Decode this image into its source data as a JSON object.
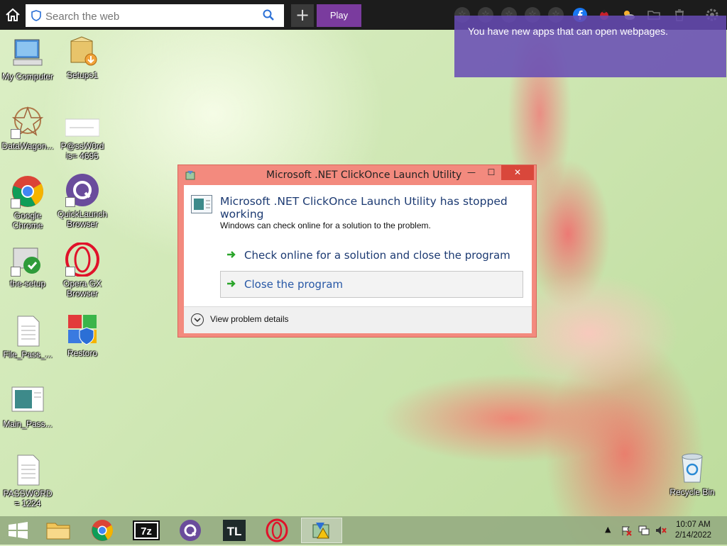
{
  "topbar": {
    "search_placeholder": "Search the web",
    "plus_label": "+",
    "play_label": "Play",
    "favorites_count": 5
  },
  "notification": {
    "text": "You have new apps that can open webpages."
  },
  "desktop_icons": [
    {
      "label": "My Computer",
      "icon": "computer-icon"
    },
    {
      "label": "Setups1",
      "icon": "installer-box-icon"
    },
    {
      "label": "DataWagon...",
      "icon": "datawagon-icon"
    },
    {
      "label": "P@ssW0rd is=  4695",
      "icon": "text-file-icon"
    },
    {
      "label": "Google Chrome",
      "icon": "chrome-icon"
    },
    {
      "label": "QuickLaunch Browser",
      "icon": "quicklaunch-icon"
    },
    {
      "label": "the-setup",
      "icon": "setup-icon"
    },
    {
      "label": "Opera GX Browser",
      "icon": "opera-icon"
    },
    {
      "label": "File_Pass_...",
      "icon": "document-icon"
    },
    {
      "label": "Restoro",
      "icon": "restoro-icon"
    },
    {
      "label": "Main_Pass...",
      "icon": "image-file-icon"
    },
    {
      "label": "PASSWORD = 1224",
      "icon": "document-icon"
    },
    {
      "label": "Recycle Bin",
      "icon": "recycle-bin-icon"
    }
  ],
  "dialog": {
    "title": "Microsoft .NET ClickOnce Launch Utility",
    "heading": "Microsoft .NET ClickOnce Launch Utility has stopped working",
    "subtext": "Windows can check online for a solution to the problem.",
    "option_check_online": "Check online for a solution and close the program",
    "option_close": "Close the program",
    "footer_details": "View problem details",
    "minimize": "—",
    "maximize": "☐",
    "close": "✕"
  },
  "taskbar": {
    "items": [
      "start-icon",
      "file-explorer-icon",
      "chrome-icon",
      "7zip-icon",
      "quicklaunch-icon",
      "tl-icon",
      "opera-icon",
      "error-app-icon"
    ],
    "sevenzip_label": "7z",
    "tl_label": "TL",
    "time": "10:07 AM",
    "date": "2/14/2022"
  },
  "colors": {
    "accent_play": "#7a3b9e",
    "notif_bg": "#664ab4",
    "dialog_frame": "#f38a7e",
    "close_btn": "#d9473b",
    "link_text": "#1c3a72"
  }
}
